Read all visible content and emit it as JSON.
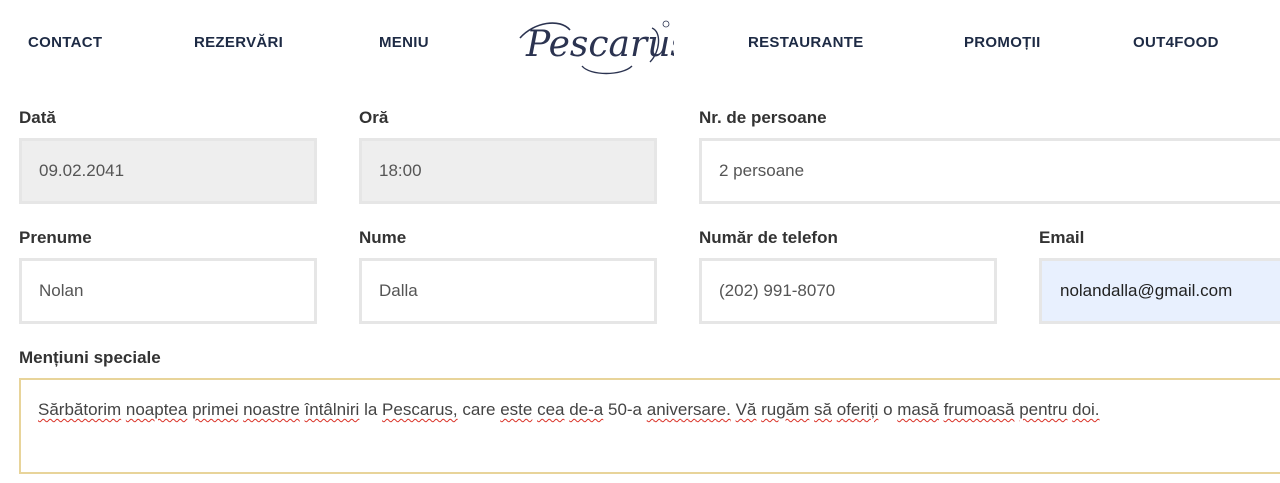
{
  "nav": {
    "contact": "CONTACT",
    "rezervari": "REZERVĂRI",
    "meniu": "MENIU",
    "logo": "Pescarus",
    "restaurante": "RESTAURANTE",
    "promotii": "PROMOȚII",
    "out4food": "OUT4FOOD"
  },
  "form": {
    "date": {
      "label": "Dată",
      "value": "09.02.2041"
    },
    "time": {
      "label": "Oră",
      "value": "18:00"
    },
    "persons": {
      "label": "Nr. de persoane",
      "value": "2 persoane"
    },
    "first_name": {
      "label": "Prenume",
      "value": "Nolan"
    },
    "last_name": {
      "label": "Nume",
      "value": "Dalla"
    },
    "phone": {
      "label": "Număr de telefon",
      "value": "(202) 991-8070"
    },
    "email": {
      "label": "Email",
      "value": "nolandalla@gmail.com"
    },
    "notes": {
      "label": "Mențiuni speciale",
      "words": [
        "Sărbătorim",
        "noaptea",
        "primei",
        "noastre",
        "întâlniri",
        "la",
        "Pescarus,",
        "care",
        "este",
        "cea",
        "de-a",
        "50-a",
        "aniversare.",
        "Vă",
        "rugăm",
        "să",
        "oferiți",
        "o",
        "masă",
        "frumoasă",
        "pentru",
        "doi."
      ]
    }
  },
  "colors": {
    "nav_text": "#1d2a44",
    "autofill_bg": "#e8f0fe",
    "readonly_bg": "#eeeeee",
    "notes_border": "#e8d49a",
    "spellcheck_underline": "#d93025"
  }
}
